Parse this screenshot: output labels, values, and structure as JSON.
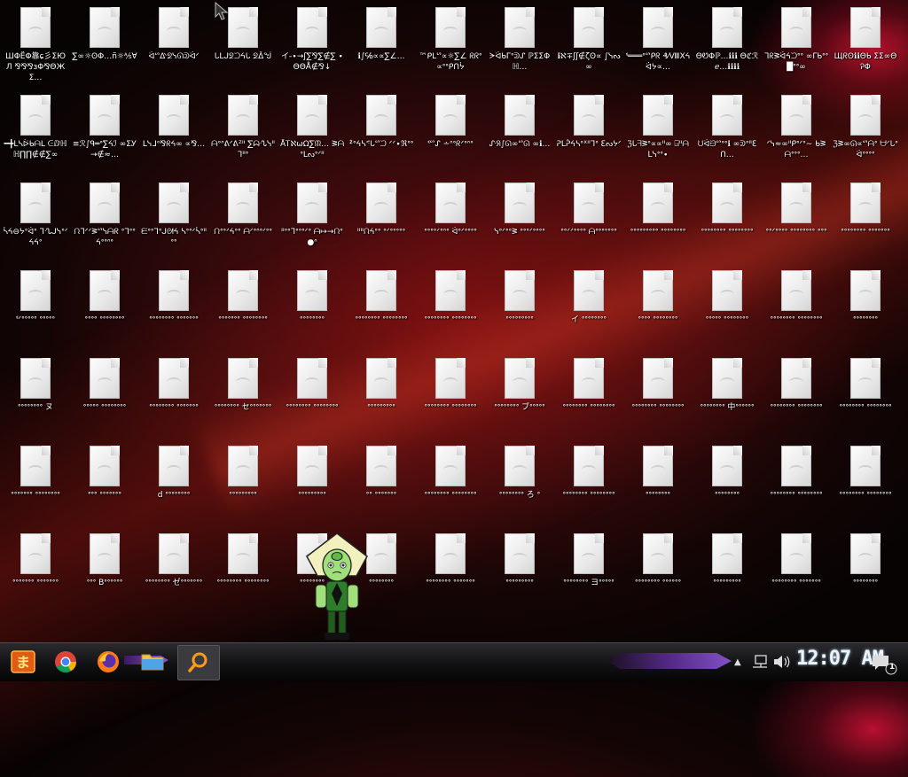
{
  "desktop": {
    "icons": [
      "ШΦЁΦ靠ɕ彡ΣЮЛ ⅋⅋⅋ɜΦ⅋ΘЖΣ…",
      "∑∞☼ʘΦ…ñ☼⅍∀",
      "ᐛᔥᐬᘖᓭᘏᕲᐛᐟ",
      "ᒐᒪᒍᘖᙂᔦᒐ ᘖᐂᖒ",
      "イ-∙→ʃ∑⅋∑∉∑ ∙ΘΘÅ∉⅋↓",
      "ℹ∫℅∝∝∑∠…",
      "™ᑭᒪᔥ∝☼∑∠ ᖇᖇᐤ∝ᐤᐤᑭᑎᔮ",
      "ᗒᐛᑲᒥᐤᕲᔑ ℙΣΣΦℍ…",
      "ℹℵ∓ʃʃ∉ζʘ∝ ∫ᓭᔓ∞",
      "ᓫ═══ᐤᔥᑭᖇ ₰⁄ⅧⅩᔦᐛᔭ∝…",
      "ΘᏬΦℙ…ℹℹℹ Θℭℛℯ…ℹℹℹℹ",
      "ᒣᖇᕒᐛᔦᙂᐤᐤ ∞ᒥᑲᐤᐤ█ᐤᐤ∞",
      "ЩᖇʘℹℹΘᑲ ΣΣ∞ΘᎮΦ",
      "━╋ᒪᓴᐖᑲᗩᒪ ᕮⅅℍℍ∏∏∉∉∑∞",
      "≡ℛ∫ᑫ═ᐤ∑ᔦℐ ∞ΣᎩ→∉≈…",
      "ᒪᓭᒧᐤ⅋ᖇᔦ∞ ∝⅋…",
      "ᗩᐤᐢᕕᐟᕕᙆᐦ ∑ᗣᔗᓭᐦᒣᐦᐤ",
      "ÅᎢℵωΩ∑ᙏ… ᕒᗩᐤᒪᔓᐤᐟᐦ",
      "ᙇᐤᔦᓴᕝᒐᔥᙂ ᐟᐟ∙ℜᐤᐤ",
      "ᓫᔥᔑ ∸ᐢᐤᖇᐟᐤᐢᐤ",
      "ᔚᖆ∫ᘏ∞ᔥᘏ ∞ℹ…",
      "ᕈᒪᕉᔦᓴᐤᕽᐦᒣᐤ ℇᔓᔭᐟ",
      "ℨᒐᖷᕒᐤ∝∝ᐦ∞ ⍈ᐦᗩᒪᓭᐤᐤ∙",
      "ᙀᐛᙌᔥᐤᐤℹ ∞ᕲᐤᐦℇᑎ…",
      "ᐟᓭ≈∞ᐦᑭᐤᐟᐤ∼ ᑲᕒᗩᐤᐤᐤ…",
      "ℨᕒ∞ᘏ∝ᔥᗩᐤ ᗨᐟᒐᐤᐛᐤᐤᐤᐤ",
      "ᓵᔦ⊖ᔭᐤᐛᐤ ᒣᔗᒍᓭᐤᐟᔦᔦᐤ",
      "ᙁᒣᐟᐟᕒᔥᓭᗩᖇ ᐤᒣᐤᐤᔦᐤᐤᐢᐤ",
      "ᙓᐤᐤᒣᐤᒍᘛᔦ ᓴᐤᐤᐟᓵᐤᐦᐤᐤ",
      "ᙁᐤᐤᐟᔦᐤᐤ ᗩᐟᐤᐢᐤᐟᐤᐤ",
      "ᐦᐤᐤᒣᐤᐤᐤᐟᐤ ᗩ↦→ᙁᐤ●ᐢ",
      "ᐦᐦᙁᔦᐤᐤ ᐤᐟᐤᐤᐤᐤᐤ",
      "ᐤᐤᐤᐤᐟᐤᐢᐤ ᐛᐤᐟᐤᐤᐤᐤ",
      "ᓭᐤᐟᐤᐤᕒ ᐤᐤᐤᐟᐤᐤᐤᐤ",
      "ᐤᐤᐟᐟᐤᐤᐤᐤ ᗩᐤᐤᐤᐤᐤᐤᐤ",
      "ᐤᐤᐤᐤᐤᐤᐤᐤᐤ ᐤᐤᐤᐤᐤᐤᐤᐤ",
      "ᐤᐤᐤᐤᐤᐤᐤᐤ ᐤᐤᐤᐤᐤᐤᐤᐤ",
      "ᐤᐤᐟᐤᐤᐤᐤ ᐤᐤᐤᐤᐤᐤᐤᐤ ᐤᐤᐤ",
      "ᐤᐤᐤᐤᐤᐤᐤᐤ ᐤᐤᐤᐤᐤᐤᐤ",
      "ᓫᐟᐤᐤᐤᐤᐤ ᐤᐤᐤᐤᐤ",
      "ᐤᐤᐤᐤ ᐤᐤᐤᐤᐤᐤᐤᐤ",
      "ᐤᐤᐤᐤᐤᐤᐤᐤ ᐤᐤᐤᐤᐤᐤᐤ",
      "ᐤᐤᐤᐤᐤᐤᐤ ᐤᐤᐤᐤᐤᐤᐤᐤ",
      "ᐤᐤᐤᐤᐤᐤᐤᐤ",
      "ᐤᐤᐤᐤᐤᐤᐤᐤ ᐤᐤᐤᐤᐤᐤᐤᐤ",
      "ᐤᐤᐤᐤᐤᐤᐤᐤ ᐤᐤᐤᐤᐤᐤᐤᐤ",
      "ᐤᐤᐤᐤᐤᐤᐤᐤᐤ",
      "イ ᐤᐤᐤᐤᐤᐤᐤᐤ",
      "ᐤᐤᐤᐤ ᐤᐤᐤᐤᐤᐤᐤᐤ",
      "ᐤᐤᐤᐤᐤ ᐤᐤᐤᐤᐤᐤᐤᐤ",
      "ᐤᐤᐤᐤᐤᐤᐤᐤ ᐤᐤᐤᐤᐤᐤᐤᐤ",
      "ᐤᐤᐤᐤᐤᐤᐤᐤ",
      "ᐤᐤᐤᐤᐤᐤᐤᐤ ヌ",
      "ᐤᐤᐤᐤᐤ ᐤᐤᐤᐤᐤᐤᐤᐤ",
      "ᐤᐤᐤᐤᐤᐤᐤᐤ ᐤᐤᐤᐤᐤᐤᐤ",
      "ᐤᐤᐤᐤᐤᐤᐤᐤ セᐤᐤᐤᐤᐤᐤᐤ",
      "ᐤᐤᐤᐤᐤᐤᐤᐤ ᐤᐤᐤᐤᐤᐤᐤᐤ",
      "ᐤᐤᐤᐤᐤᐤᐤᐤᐤ",
      "ᐤᐤᐤᐤᐤᐤᐤᐤ ᐤᐤᐤᐤᐤᐤᐤᐤ",
      "ᐤᐤᐤᐤᐤᐤᐤᐤ ブᐤᐤᐤᐤᐤ",
      "ᐤᐤᐤᐤᐤᐤᐤᐤ ᐤᐤᐤᐤᐤᐤᐤᐤ",
      "ᐤᐤᐤᐤᐤᐤᐤᐤ ᐤᐤᐤᐤᐤᐤᐤᐤ",
      "ᐤᐤᐤᐤᐤᐤᐤᐤ 中ᐤᐤᐤᐤᐤᐤ",
      "ᐤᐤᐤᐤᐤᐤᐤᐤ ᐤᐤᐤᐤᐤᐤᐤᐤ",
      "ᐤᐤᐤᐤᐤᐤᐤᐤ ᐤᐤᐤᐤᐤᐤᐤᐤ",
      "ᐤᐤᐤᐤᐤᐤᐤ ᐤᐤᐤᐤᐤᐤᐤᐤ",
      "ᐤᐤᐤ ᐤᐤᐤᐤᐤᐤᐤ",
      "d ᐤᐤᐤᐤᐤᐤᐤᐤ",
      "ᐤᐤᐤᐤᐤᐤᐤᐤᐤ",
      "ᐤᐤᐤᐤᐤᐤᐤᐤᐤ",
      "ᐤᐤ ᐤᐤᐤᐤᐤᐤᐤ",
      "ᐤᐤᐤᐤᐤᐤᐤᐤ ᐤᐤᐤᐤᐤᐤᐤᐤ",
      "ᐤᐤᐤᐤᐤᐤᐤᐤ ろ ᐤ",
      "ᐤᐤᐤᐤᐤᐤᐤᐤ ᐤᐤᐤᐤᐤᐤᐤᐤ",
      "ᐤᐤᐤᐤᐤᐤᐤᐤ",
      "ᐤᐤᐤᐤᐤᐤᐤᐤ",
      "ᐤᐤᐤᐤᐤᐤᐤᐤ ᐤᐤᐤᐤᐤᐤᐤᐤ",
      "ᐤᐤᐤᐤᐤᐤᐤᐤ ᐤᐤᐤᐤᐤᐤᐤᐤ",
      "ᐤᐤᐤᐤᐤᐤᐤ ᐤᐤᐤᐤᐤᐤᐤ",
      "ᐤᐤᐤ Bᐤᐤᐤᐤᐤᐤ",
      "ᐤᐤᐤᐤᐤᐤᐤᐤ ゼᐤᐤᐤᐤᐤᐤᐤ",
      "ᐤᐤᐤᐤᐤᐤᐤᐤ ᐤᐤᐤᐤᐤᐤᐤᐤ",
      "ᐤᐤᐤᐤᐤᐤᐤᐤ",
      "ᐤᐤᐤᐤᐤᐤᐤᐤ",
      "ᐤᐤᐤᐤᐤᐤᐤᐤ ᐤᐤᐤᐤᐤᐤᐤ",
      "ᐤᐤᐤᐤᐤᐤᐤᐤᐤ",
      "ᐤᐤᐤᐤᐤᐤᐤᐤ ヨᐤᐤᐤᐤᐤ",
      "ᐤᐤᐤᐤᐤᐤᐤᐤ ᐤᐤᐤᐤᐤᐤ",
      "ᐤᐤᐤᐤᐤᐤᐤᐤᐤ",
      "ᐤᐤᐤᐤᐤᐤᐤᐤ ᐤᐤᐤᐤᐤᐤᐤ",
      "ᐤᐤᐤᐤᐤᐤᐤᐤ"
    ]
  },
  "taskbar": {
    "clock": "12:07 AM",
    "notification_count": "1",
    "apps": [
      "start-menu",
      "chrome",
      "firefox",
      "file-explorer",
      "search"
    ]
  },
  "colors": {
    "wallpaper_primary": "#6e0d10",
    "wallpaper_accent": "#b81030",
    "taskbar_accent": "#8d58d8"
  }
}
